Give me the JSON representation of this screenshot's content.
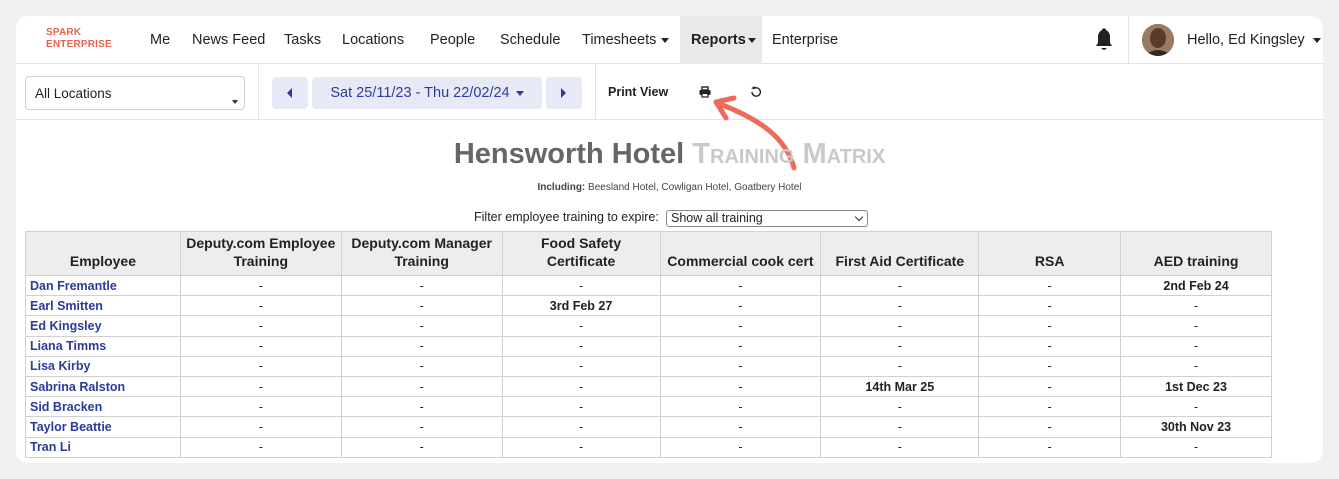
{
  "logo": {
    "line1": "SPARK",
    "line2": "ENTERPRISE"
  },
  "nav": {
    "items": [
      {
        "label": "Me"
      },
      {
        "label": "News Feed"
      },
      {
        "label": "Tasks"
      },
      {
        "label": "Locations"
      },
      {
        "label": "People"
      },
      {
        "label": "Schedule"
      },
      {
        "label": "Timesheets"
      },
      {
        "label": "Reports"
      },
      {
        "label": "Enterprise"
      }
    ],
    "greeting": "Hello, Ed Kingsley"
  },
  "toolbar": {
    "location": "All Locations",
    "date_range": "Sat 25/11/23 - Thu 22/02/24",
    "print_view": "Print View"
  },
  "report": {
    "title_main": "Hensworth Hotel",
    "title_sub": "Training Matrix",
    "including_label": "Including:",
    "including_value": "Beesland Hotel, Cowligan Hotel, Goatbery Hotel",
    "filter_label": "Filter employee training to expire:",
    "filter_value": "Show all training"
  },
  "table": {
    "headers": [
      "Employee",
      "Deputy.com Employee Training",
      "Deputy.com Manager Training",
      "Food Safety Certificate",
      "Commercial cook cert",
      "First Aid Certificate",
      "RSA",
      "AED training"
    ],
    "rows": [
      [
        "Dan Fremantle",
        "-",
        "-",
        "-",
        "-",
        "-",
        "-",
        "2nd Feb 24"
      ],
      [
        "Earl Smitten",
        "-",
        "-",
        "3rd Feb 27",
        "-",
        "-",
        "-",
        "-"
      ],
      [
        "Ed Kingsley",
        "-",
        "-",
        "-",
        "-",
        "-",
        "-",
        "-"
      ],
      [
        "Liana Timms",
        "-",
        "-",
        "-",
        "-",
        "-",
        "-",
        "-"
      ],
      [
        "Lisa Kirby",
        "-",
        "-",
        "-",
        "-",
        "-",
        "-",
        "-"
      ],
      [
        "Sabrina Ralston",
        "-",
        "-",
        "-",
        "-",
        "14th Mar 25",
        "-",
        "1st Dec 23"
      ],
      [
        "Sid Bracken",
        "-",
        "-",
        "-",
        "-",
        "-",
        "-",
        "-"
      ],
      [
        "Taylor Beattie",
        "-",
        "-",
        "-",
        "-",
        "-",
        "-",
        "30th Nov 23"
      ],
      [
        "Tran Li",
        "-",
        "-",
        "-",
        "-",
        "-",
        "-",
        "-"
      ]
    ]
  },
  "icons": {
    "bell": "bell-icon",
    "print": "printer-icon",
    "refresh": "refresh-icon",
    "prev": "prev-arrow-icon",
    "next": "next-arrow-icon"
  },
  "colors": {
    "accent": "#2f3b9a",
    "brand": "#e8624f",
    "arrow": "#ee6b5c"
  }
}
